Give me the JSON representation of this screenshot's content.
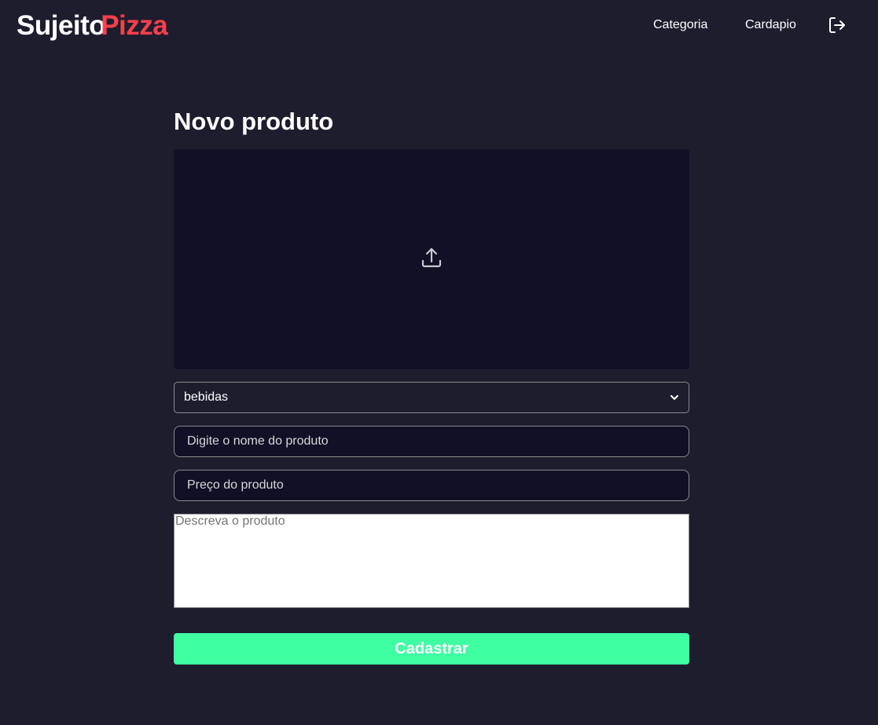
{
  "header": {
    "logo": {
      "part1": "Sujeito",
      "part2": "Pizza"
    },
    "nav": [
      {
        "label": "Categoria"
      },
      {
        "label": "Cardapio"
      }
    ],
    "logout_icon": "logout-icon"
  },
  "form": {
    "title": "Novo produto",
    "upload_icon": "upload-icon",
    "category_select": {
      "value": "bebidas"
    },
    "name_placeholder": "Digite o nome do produto",
    "price_placeholder": "Preço do produto",
    "description_placeholder": "Descreva o produto",
    "submit_label": "Cadastrar"
  },
  "colors": {
    "background": "#1d1d2e",
    "surface": "#101026",
    "brand_red": "#ff3f4b",
    "accent_green": "#3fffa3"
  }
}
